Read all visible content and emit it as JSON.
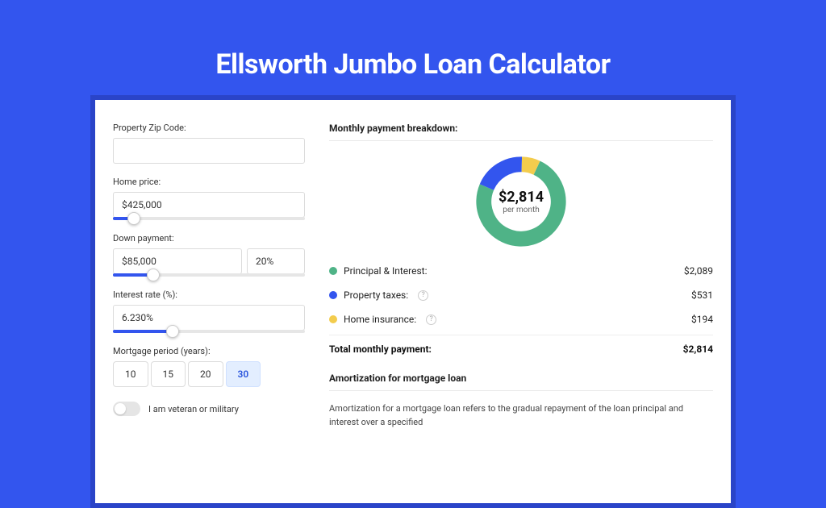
{
  "page": {
    "title": "Ellsworth Jumbo Loan Calculator"
  },
  "form": {
    "zip_label": "Property Zip Code:",
    "zip_value": "",
    "home_price_label": "Home price:",
    "home_price_value": "$425,000",
    "home_price_slider_pct": 11,
    "down_payment_label": "Down payment:",
    "down_payment_value": "$85,000",
    "down_payment_pct": "20%",
    "down_payment_slider_pct": 21,
    "interest_label": "Interest rate (%):",
    "interest_value": "6.230%",
    "interest_slider_pct": 31,
    "period_label": "Mortgage period (years):",
    "periods": [
      "10",
      "15",
      "20",
      "30"
    ],
    "period_selected": "30",
    "veteran_label": "I am veteran or military"
  },
  "breakdown": {
    "title": "Monthly payment breakdown:",
    "center_amount": "$2,814",
    "center_sub": "per month",
    "items": [
      {
        "label": "Principal & Interest:",
        "value": "$2,089",
        "color": "green"
      },
      {
        "label": "Property taxes:",
        "value": "$531",
        "color": "blue",
        "help": true
      },
      {
        "label": "Home insurance:",
        "value": "$194",
        "color": "yellow",
        "help": true
      }
    ],
    "total_label": "Total monthly payment:",
    "total_value": "$2,814"
  },
  "amortization": {
    "title": "Amortization for mortgage loan",
    "text": "Amortization for a mortgage loan refers to the gradual repayment of the loan principal and interest over a specified"
  },
  "chart_data": {
    "type": "pie",
    "title": "Monthly payment breakdown",
    "series": [
      {
        "name": "Principal & Interest",
        "value": 2089,
        "color": "#4fb387"
      },
      {
        "name": "Property taxes",
        "value": 531,
        "color": "#3355ee"
      },
      {
        "name": "Home insurance",
        "value": 194,
        "color": "#f3cc4d"
      }
    ],
    "total": 2814,
    "center_label": "$2,814 per month"
  }
}
